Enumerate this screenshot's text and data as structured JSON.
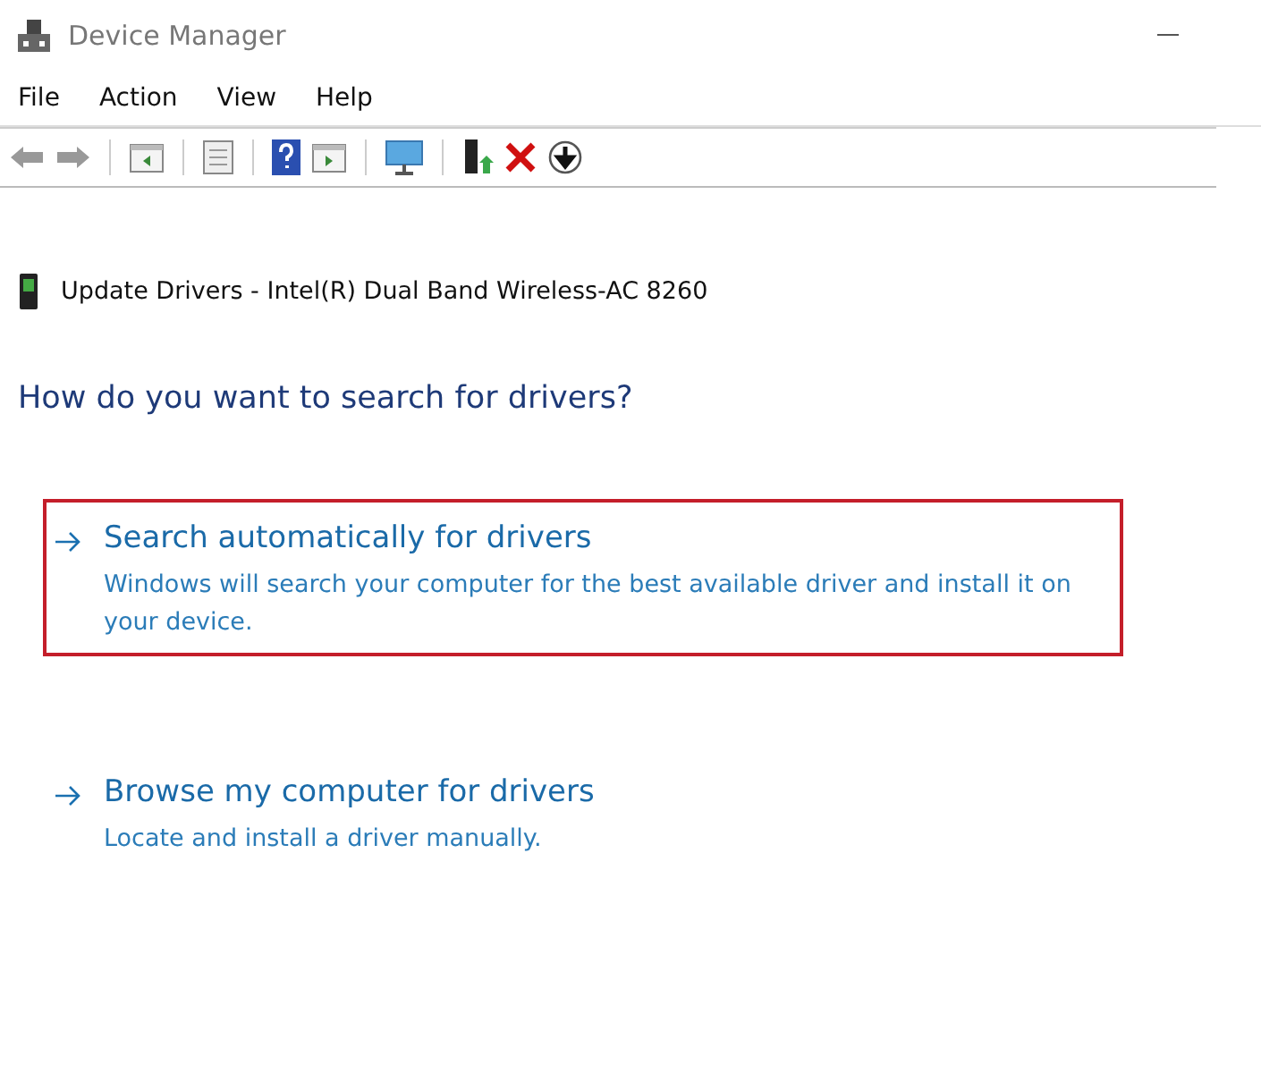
{
  "window": {
    "title": "Device Manager"
  },
  "menu": [
    "File",
    "Action",
    "View",
    "Help"
  ],
  "dialog": {
    "title": "Update Drivers - Intel(R) Dual Band Wireless-AC 8260",
    "question": "How do you want to search for drivers?",
    "options": [
      {
        "title": "Search automatically for drivers",
        "description": "Windows will search your computer for the best available driver and install it on your device.",
        "highlighted": true
      },
      {
        "title": "Browse my computer for drivers",
        "description": "Locate and install a driver manually.",
        "highlighted": false
      }
    ]
  }
}
